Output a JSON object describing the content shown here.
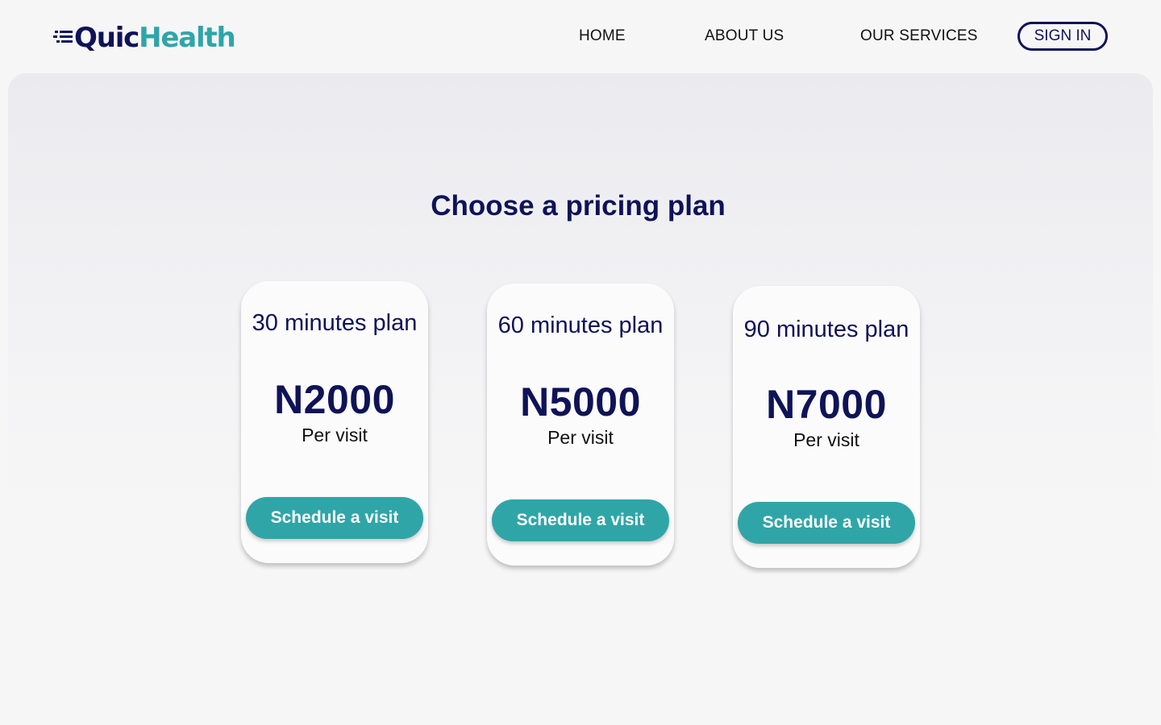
{
  "brand": {
    "prefix": "Quic",
    "suffix": "Health"
  },
  "nav": {
    "home": "HOME",
    "about": "ABOUT US",
    "services": "OUR SERVICES",
    "signin": "SIGN IN"
  },
  "main": {
    "title": "Choose a pricing plan",
    "plans": [
      {
        "name": "30 minutes plan",
        "price": "N2000",
        "unit": "Per visit",
        "cta": "Schedule a visit"
      },
      {
        "name": "60 minutes plan",
        "price": "N5000",
        "unit": "Per visit",
        "cta": "Schedule a visit"
      },
      {
        "name": "90 minutes plan",
        "price": "N7000",
        "unit": "Per visit",
        "cta": "Schedule a visit"
      }
    ]
  },
  "colors": {
    "navy": "#0f1357",
    "teal": "#30a5a8",
    "background": "#f6f6f7"
  }
}
